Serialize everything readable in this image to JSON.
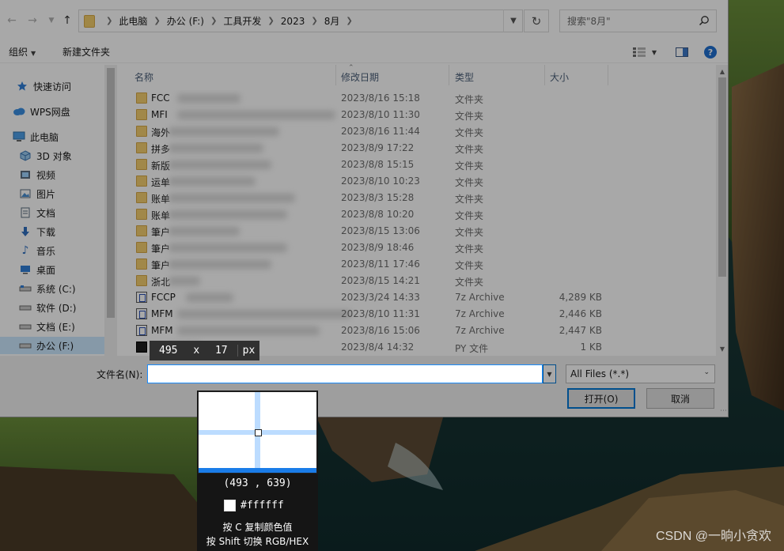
{
  "nav": {
    "breadcrumbs": [
      "此电脑",
      "办公 (F:)",
      "工具开发",
      "2023",
      "8月"
    ],
    "search_placeholder": "搜索\"8月\""
  },
  "toolbar": {
    "organize": "组织",
    "new_folder": "新建文件夹"
  },
  "sidebar": {
    "items": [
      {
        "label": "快速访问",
        "icon": "star-icon"
      },
      {
        "label": "WPS网盘",
        "icon": "cloud-icon"
      },
      {
        "label": "此电脑",
        "icon": "computer-icon"
      },
      {
        "label": "3D 对象",
        "icon": "cube-icon"
      },
      {
        "label": "视频",
        "icon": "video-icon"
      },
      {
        "label": "图片",
        "icon": "picture-icon"
      },
      {
        "label": "文档",
        "icon": "document-icon"
      },
      {
        "label": "下载",
        "icon": "download-icon"
      },
      {
        "label": "音乐",
        "icon": "music-icon"
      },
      {
        "label": "桌面",
        "icon": "desktop-icon"
      },
      {
        "label": "系统 (C:)",
        "icon": "drive-icon"
      },
      {
        "label": "软件 (D:)",
        "icon": "drive-icon"
      },
      {
        "label": "文档 (E:)",
        "icon": "drive-icon"
      },
      {
        "label": "办公 (F:)",
        "icon": "drive-icon"
      }
    ]
  },
  "columns": {
    "name": "名称",
    "modified": "修改日期",
    "type": "类型",
    "size": "大小"
  },
  "files": [
    {
      "name": "FCC",
      "date": "2023/8/16 15:18",
      "type": "文件夹",
      "size": "",
      "kind": "folder"
    },
    {
      "name": "MFI",
      "date": "2023/8/10 11:30",
      "type": "文件夹",
      "size": "",
      "kind": "folder"
    },
    {
      "name": "海外",
      "date": "2023/8/16 11:44",
      "type": "文件夹",
      "size": "",
      "kind": "folder"
    },
    {
      "name": "拼多",
      "date": "2023/8/9 17:22",
      "type": "文件夹",
      "size": "",
      "kind": "folder"
    },
    {
      "name": "新版",
      "date": "2023/8/8 15:15",
      "type": "文件夹",
      "size": "",
      "kind": "folder"
    },
    {
      "name": "运单",
      "date": "2023/8/10 10:23",
      "type": "文件夹",
      "size": "",
      "kind": "folder"
    },
    {
      "name": "账单",
      "date": "2023/8/3 15:28",
      "type": "文件夹",
      "size": "",
      "kind": "folder"
    },
    {
      "name": "账单",
      "date": "2023/8/8 10:20",
      "type": "文件夹",
      "size": "",
      "kind": "folder"
    },
    {
      "name": "筆户",
      "date": "2023/8/15 13:06",
      "type": "文件夹",
      "size": "",
      "kind": "folder"
    },
    {
      "name": "筆户",
      "date": "2023/8/9 18:46",
      "type": "文件夹",
      "size": "",
      "kind": "folder"
    },
    {
      "name": "筆户",
      "date": "2023/8/11 17:46",
      "type": "文件夹",
      "size": "",
      "kind": "folder"
    },
    {
      "name": "浙北",
      "date": "2023/8/15 14:21",
      "type": "文件夹",
      "size": "",
      "kind": "folder"
    },
    {
      "name": "FCCP",
      "date": "2023/3/24 14:33",
      "type": "7z Archive",
      "size": "4,289 KB",
      "kind": "archive"
    },
    {
      "name": "MFM",
      "date": "2023/8/10 11:31",
      "type": "7z Archive",
      "size": "2,446 KB",
      "kind": "archive"
    },
    {
      "name": "MFM",
      "date": "2023/8/16 15:06",
      "type": "7z Archive",
      "size": "2,447 KB",
      "kind": "archive"
    },
    {
      "name": "",
      "date": "2023/8/4 14:32",
      "type": "PY 文件",
      "size": "1 KB",
      "kind": "py"
    }
  ],
  "bottom": {
    "filename_label": "文件名(N):",
    "filename_value": "",
    "filter": "All Files (*.*)",
    "open": "打开(O)",
    "cancel": "取消"
  },
  "capture": {
    "size_w": "495",
    "size_x": "x",
    "size_h": "17",
    "size_unit": "px",
    "coord": "(493 , 639)",
    "color_hex": "#ffffff",
    "hint_copy": "按 C 复制颜色值",
    "hint_switch": "按 Shift 切换 RGB/HEX"
  },
  "watermark": "CSDN @一晌小贪欢",
  "colors": {
    "accent": "#0078d7",
    "sampled": "#ffffff"
  }
}
